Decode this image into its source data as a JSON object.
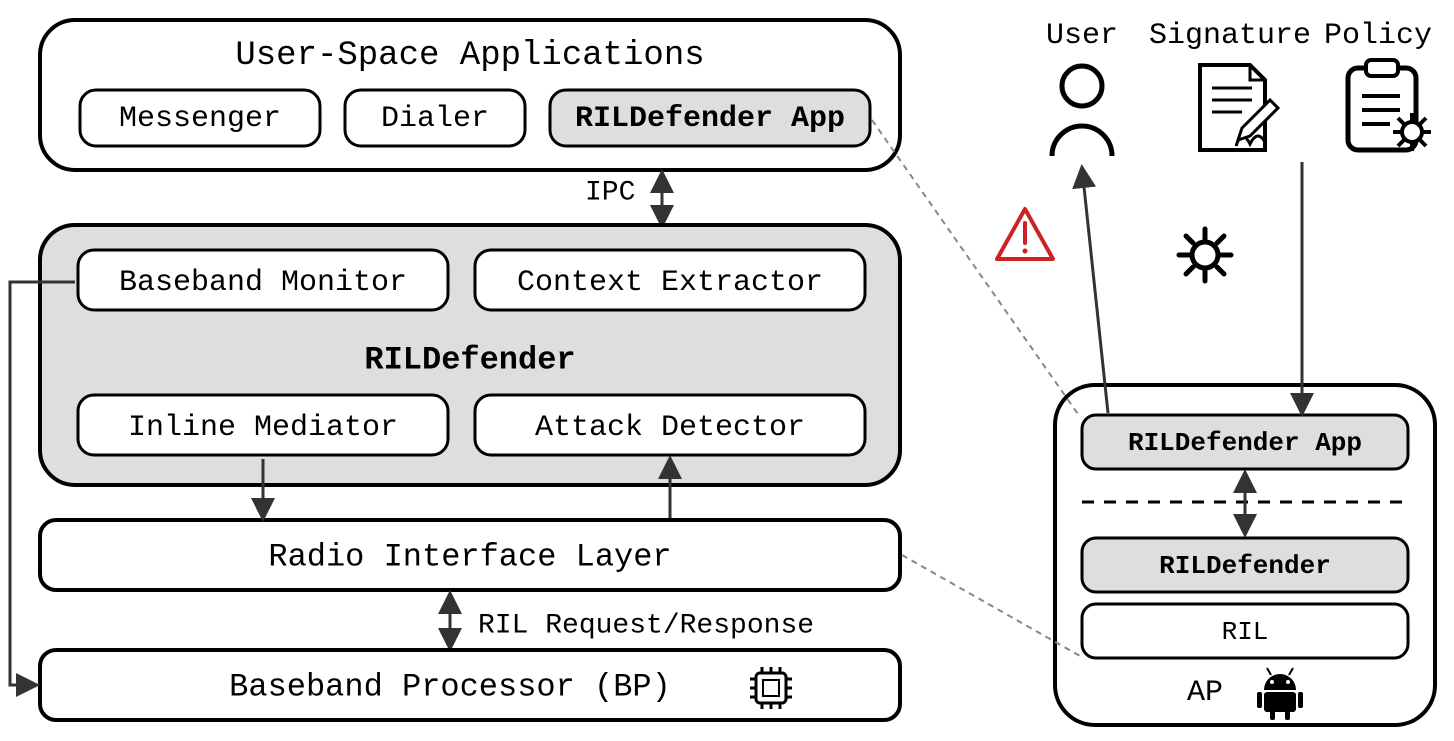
{
  "left": {
    "userspace_title": "User-Space Applications",
    "messenger": "Messenger",
    "dialer": "Dialer",
    "rild_app": "RILDefender App",
    "rildefender_title": "RILDefender",
    "baseband_monitor": "Baseband Monitor",
    "context_extractor": "Context Extractor",
    "inline_mediator": "Inline Mediator",
    "attack_detector": "Attack Detector",
    "ril_layer": "Radio Interface Layer",
    "baseband_processor": "Baseband Processor (BP)",
    "ipc": "IPC",
    "ril_reqresp": "RIL Request/Response"
  },
  "right": {
    "user": "User",
    "signature": "Signature",
    "policy": "Policy",
    "rild_app": "RILDefender App",
    "rildefender": "RILDefender",
    "ril": "RIL",
    "ap": "AP"
  }
}
